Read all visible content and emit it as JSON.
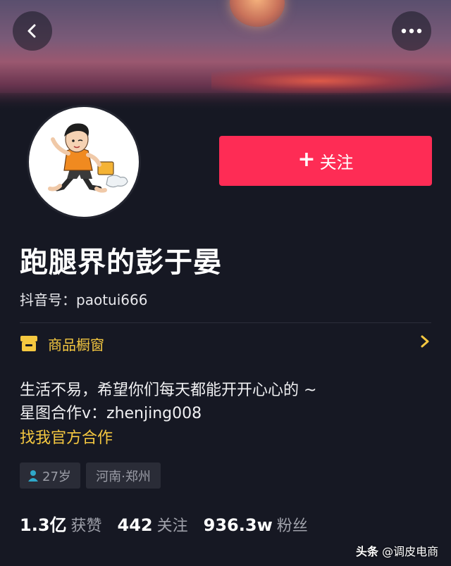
{
  "header": {
    "back_icon": "chevron-left-icon",
    "more_icon": "more-dots-icon"
  },
  "profile": {
    "avatar_icon": "cartoon-runner-avatar",
    "follow_button": {
      "plus": "+",
      "label": "关注"
    },
    "follow_color": "#fe2c55",
    "name": "跑腿界的彭于晏",
    "douyin_id_label": "抖音号：",
    "douyin_id": "paotui666"
  },
  "shop": {
    "icon": "store-icon",
    "label": "商品橱窗",
    "chevron_icon": "chevron-right-icon",
    "accent_color": "#f5c840"
  },
  "bio": {
    "line1": "生活不易，希望你们每天都能开开心心的 ~",
    "line2": "星图合作v：zhenjing008",
    "link": "找我官方合作"
  },
  "tags": {
    "age_icon": "person-icon",
    "age": "27岁",
    "location": "河南·郑州"
  },
  "stats": [
    {
      "value": "1.3亿",
      "label": "获赞"
    },
    {
      "value": "442",
      "label": "关注"
    },
    {
      "value": "936.3w",
      "label": "粉丝"
    }
  ],
  "watermark": {
    "brand": "头条",
    "handle": "@调皮电商"
  }
}
